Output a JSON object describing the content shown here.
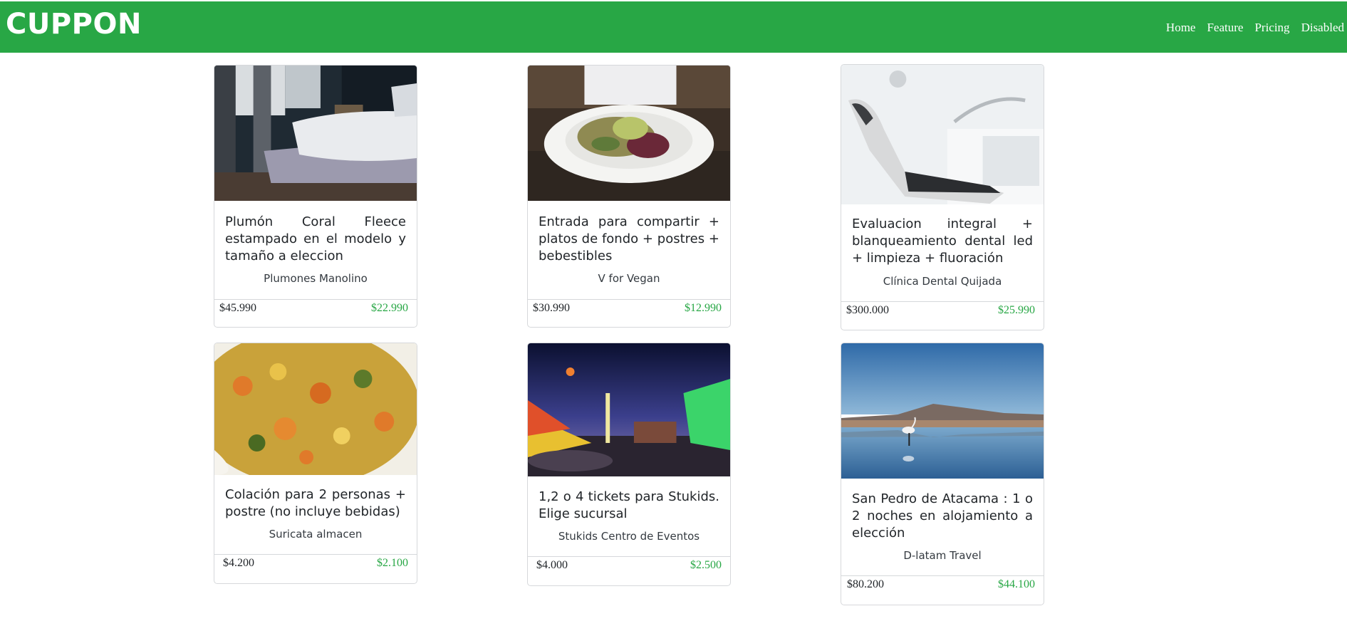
{
  "brand": "CUPPON",
  "nav": [
    "Home",
    "Feature",
    "Pricing",
    "Disabled"
  ],
  "cards": [
    {
      "title": "Plumón Coral Fleece estampado en el modelo y tamaño a eleccion",
      "vendor": "Plumones Manolino",
      "old_price": "$45.990",
      "new_price": "$22.990",
      "image_icon": "bedroom-photo"
    },
    {
      "title": "Entrada para compartir + platos de fondo + postres + bebestibles",
      "vendor": "V for Vegan",
      "old_price": "$30.990",
      "new_price": "$12.990",
      "image_icon": "salad-plate-photo"
    },
    {
      "title": "Evaluacion integral + blanqueamiento dental led + limpieza + fluoración",
      "vendor": "Clínica Dental Quijada",
      "old_price": "$300.000",
      "new_price": "$25.990",
      "image_icon": "dental-chair-photo"
    },
    {
      "title": "Colación para 2 personas + postre (no incluye bebidas)",
      "vendor": "Suricata almacen",
      "old_price": "$4.200",
      "new_price": "$2.100",
      "image_icon": "stew-dish-photo"
    },
    {
      "title": "1,2 o 4 tickets para Stukids. Elige sucursal",
      "vendor": "Stukids Centro de Eventos",
      "old_price": "$4.000",
      "new_price": "$2.500",
      "image_icon": "fairground-night-photo"
    },
    {
      "title": "San Pedro de Atacama : 1 o 2 noches en alojamiento a elección",
      "vendor": "D-latam Travel",
      "old_price": "$80.200",
      "new_price": "$44.100",
      "image_icon": "flamingo-lagoon-photo"
    }
  ],
  "colors": {
    "navbar": "#28a745",
    "price_new": "#28a745",
    "text": "#212529"
  }
}
